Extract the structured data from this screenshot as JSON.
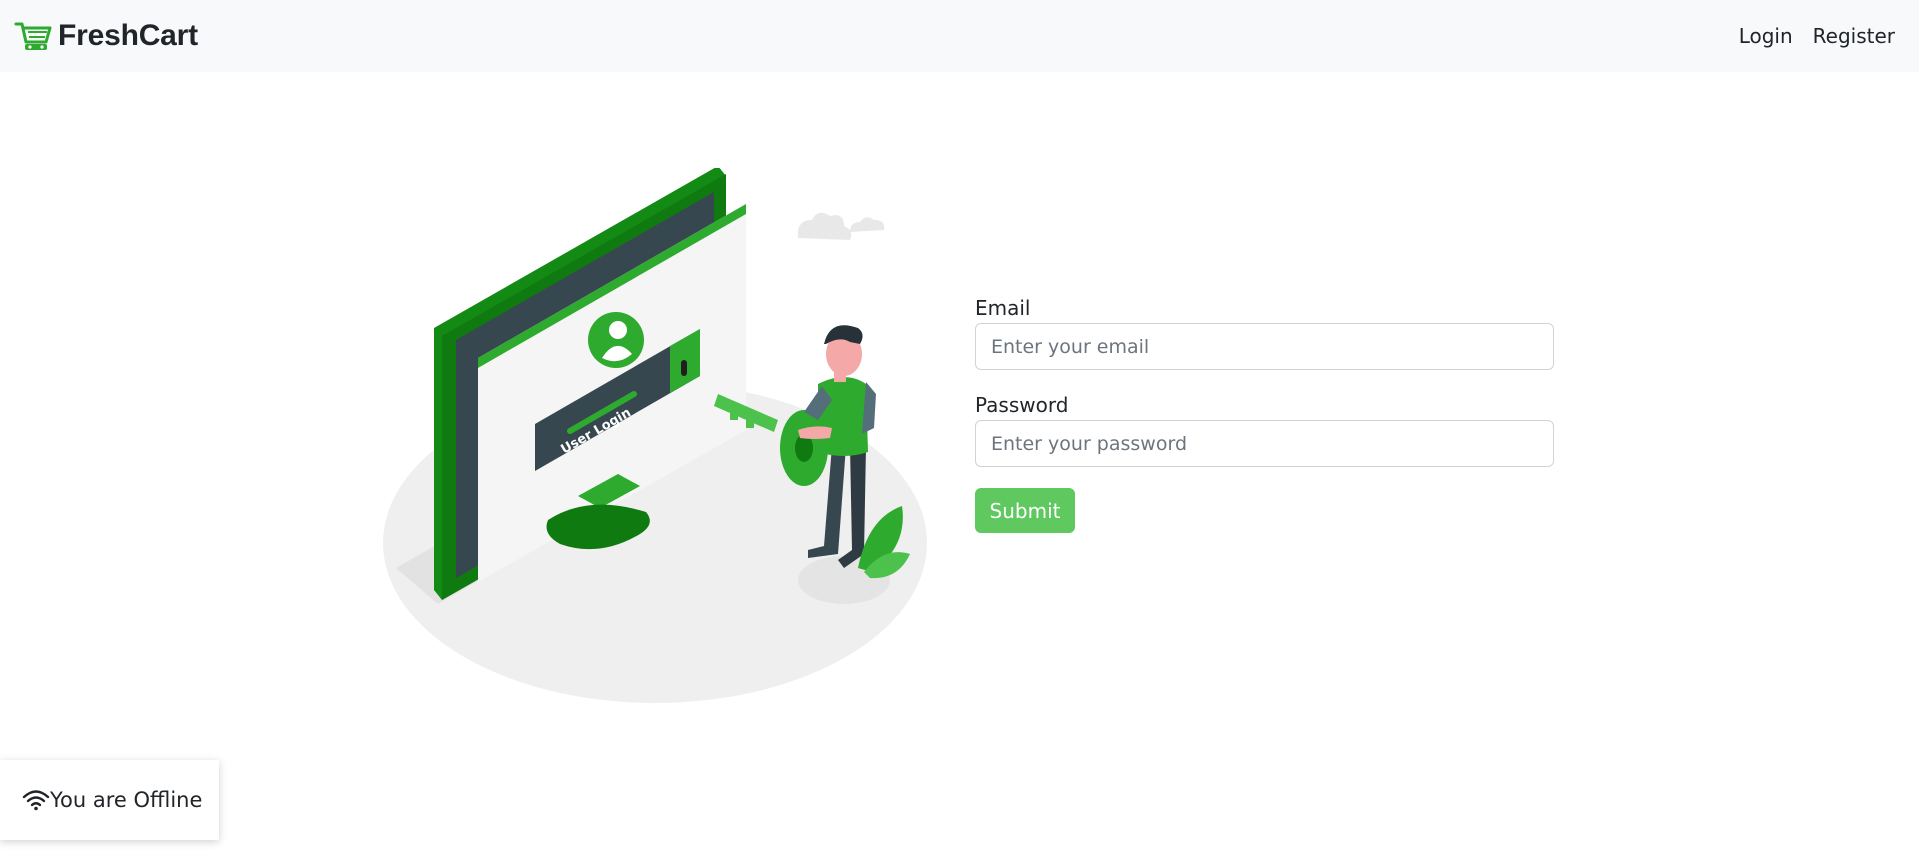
{
  "navbar": {
    "brand": "FreshCart",
    "links": [
      {
        "label": "Login"
      },
      {
        "label": "Register"
      }
    ]
  },
  "illustration": {
    "screen_text": "User Login"
  },
  "form": {
    "email_label": "Email",
    "email_placeholder": "Enter your email",
    "email_value": "",
    "password_label": "Password",
    "password_placeholder": "Enter your password",
    "password_value": "",
    "submit_label": "Submit"
  },
  "status": {
    "offline_message": "You are Offline"
  },
  "colors": {
    "accent": "#5fc85f",
    "brand_green": "#2eaa2e",
    "dark_green": "#138a13",
    "navbar_bg": "#f8f9fa"
  },
  "icons": {
    "brand": "cart-icon",
    "offline": "wifi-icon"
  }
}
